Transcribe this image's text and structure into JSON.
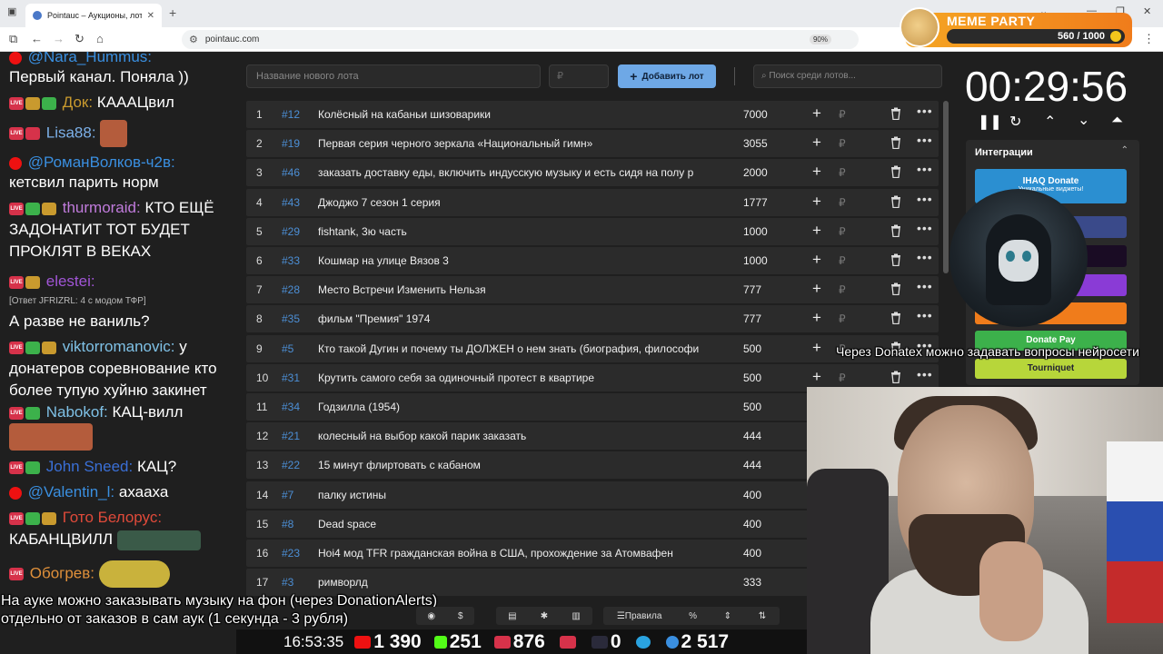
{
  "browser": {
    "tab_title": "Pointauc – Аукционы, лотереи",
    "url": "pointauc.com",
    "zoom": "90%"
  },
  "meme_party": {
    "title": "MEME PARTY",
    "progress_text": "560 / 1000",
    "progress": 0.56
  },
  "chat": {
    "messages": [
      {
        "nick": "@Nara_Hummus:",
        "text": "",
        "nick_color": "#3a8fe0"
      },
      {
        "nick": "",
        "text": "Первый канал. Поняла ))",
        "nick_color": "#fff"
      },
      {
        "nick": "Док:",
        "text": "КАААЦвил",
        "nick_color": "#c99a2e"
      },
      {
        "nick": "Lisa88:",
        "text": "",
        "nick_color": "#7cb0e8"
      },
      {
        "nick": "@РоманВолков-ч2в:",
        "text": "",
        "nick_color": "#3a8fe0"
      },
      {
        "nick": "",
        "text": "кетсвил парить норм",
        "nick_color": "#fff"
      },
      {
        "nick": "thurmoraid:",
        "text": "КТО ЕЩЁ ЗАДОНАТИТ ТОТ БУДЕТ ПРОКЛЯТ В ВЕКАХ",
        "nick_color": "#c07bdb"
      },
      {
        "nick": "elestei:",
        "text": "",
        "nick_color": "#a155d6"
      },
      {
        "nick": "[Ответ JFRIZRL: 4 с модом ТФР]",
        "text": "",
        "nick_color": "#bbb"
      },
      {
        "nick": "",
        "text": "А разве не ваниль?",
        "nick_color": "#fff"
      },
      {
        "nick": "viktorromanovic:",
        "text": "у донатеров соревнование кто более тупую хуйню закинет",
        "nick_color": "#7fc1e6"
      },
      {
        "nick": "Nabokof:",
        "text": "КАЦ-вилл",
        "nick_color": "#7fc1e6"
      },
      {
        "nick": "John Sneed:",
        "text": "КАЦ?",
        "nick_color": "#3a6fd6"
      },
      {
        "nick": "@Valentin_l:",
        "text": "ахааха",
        "nick_color": "#3a8fe0"
      },
      {
        "nick": "Гото Белорус:",
        "text": "КАБАНЦВИЛЛ",
        "nick_color": "#e04a3a"
      },
      {
        "nick": "Обогрев:",
        "text": "",
        "nick_color": "#e0903a"
      }
    ]
  },
  "form": {
    "lot_placeholder": "Название нового лота",
    "rub_placeholder": "₽",
    "add_label": "Добавить лот",
    "search_placeholder": "Поиск среди лотов..."
  },
  "lots": [
    {
      "n": "1",
      "id": "#12",
      "name": "Колёсный на кабаньи шизоварики",
      "amount": "7000"
    },
    {
      "n": "2",
      "id": "#19",
      "name": "Первая серия черного зеркала «Национальный гимн»",
      "amount": "3055"
    },
    {
      "n": "3",
      "id": "#46",
      "name": "заказать доставку еды, включить индусскую музыку и есть сидя на полу р",
      "amount": "2000"
    },
    {
      "n": "4",
      "id": "#43",
      "name": "Джоджо 7 сезон 1 серия",
      "amount": "1777"
    },
    {
      "n": "5",
      "id": "#29",
      "name": "fishtank, 3ю часть",
      "amount": "1000"
    },
    {
      "n": "6",
      "id": "#33",
      "name": "Кошмар на улице Вязов 3",
      "amount": "1000"
    },
    {
      "n": "7",
      "id": "#28",
      "name": "Место Встречи Изменить Нельзя",
      "amount": "777"
    },
    {
      "n": "8",
      "id": "#35",
      "name": "фильм \"Премия\" 1974",
      "amount": "777"
    },
    {
      "n": "9",
      "id": "#5",
      "name": "Кто такой Дугин и почему ты ДОЛЖЕН о нем знать (биография, философи",
      "amount": "500"
    },
    {
      "n": "10",
      "id": "#31",
      "name": "Крутить самого себя за одиночный протест в квартире",
      "amount": "500"
    },
    {
      "n": "11",
      "id": "#34",
      "name": "Годзилла (1954)",
      "amount": "500"
    },
    {
      "n": "12",
      "id": "#21",
      "name": "колесный на выбор какой парик заказать",
      "amount": "444"
    },
    {
      "n": "13",
      "id": "#22",
      "name": "15 минут флиртовать с кабаном",
      "amount": "444"
    },
    {
      "n": "14",
      "id": "#7",
      "name": "палку истины",
      "amount": "400"
    },
    {
      "n": "15",
      "id": "#8",
      "name": "Dead space",
      "amount": "400"
    },
    {
      "n": "16",
      "id": "#23",
      "name": "Hoi4 мод TFR гражданская война в США, прохождение за Атомвафен",
      "amount": "400"
    },
    {
      "n": "17",
      "id": "#3",
      "name": "римворлд",
      "amount": "333"
    }
  ],
  "row_currency": "₽",
  "timer": {
    "value": "00:29:56"
  },
  "integrations": {
    "header": "Интеграции",
    "buttons": [
      {
        "label": "IHAQ Donate",
        "sub": "Уникальные виджеты!",
        "color": "#2b8fd1"
      },
      {
        "label": "Donate Pay",
        "sub": "",
        "color": "#3cb14b"
      },
      {
        "label": "Tourniquet",
        "sub": "",
        "color": "#b7d63a"
      }
    ]
  },
  "overlay": {
    "right_text": "Через Donatex можно задавать вопросы нейросети",
    "bottom_line1": "На ауке можно заказывать музыку на фон (через DonationAlerts)",
    "bottom_line2": "отдельно от заказов в сам аук (1 секунда - 3 рубля)"
  },
  "toolbar": {
    "rules_label": "Правила"
  },
  "stats": {
    "clock": "16:53:35",
    "youtube": "1 390",
    "kick": "251",
    "vklive": "876",
    "rutube": "0",
    "telegram": "",
    "viewers": "2 517"
  }
}
